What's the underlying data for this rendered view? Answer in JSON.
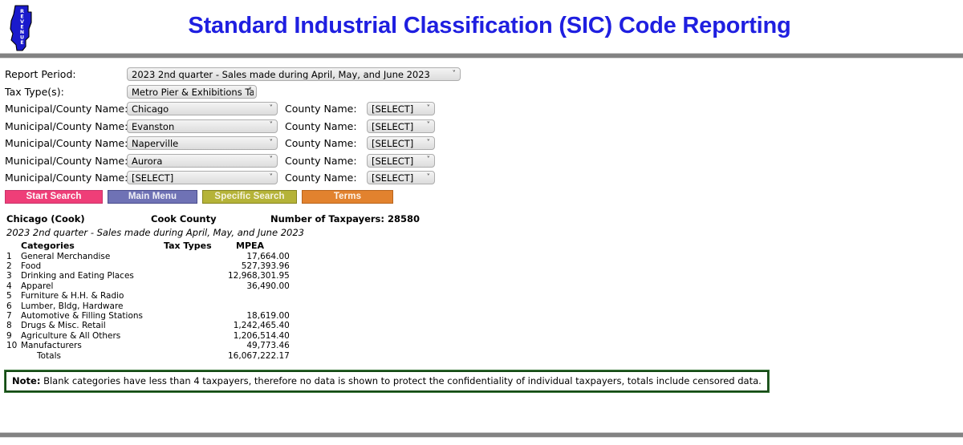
{
  "header": {
    "title": "Standard Industrial Classification (SIC) Code Reporting",
    "logo_text": "REVENUE",
    "title_color": "#1f1fe0"
  },
  "form": {
    "report_period_label": "Report Period:",
    "report_period_value": "2023 2nd quarter - Sales made during April, May, and June 2023",
    "tax_type_label": "Tax Type(s):",
    "tax_type_value": "Metro Pier & Exhibitions Tax",
    "municipal_label": "Municipal/County Name:",
    "county_label": "County Name:",
    "select_placeholder": "[SELECT]",
    "rows": [
      {
        "municipal": "Chicago",
        "county": "[SELECT]"
      },
      {
        "municipal": "Evanston",
        "county": "[SELECT]"
      },
      {
        "municipal": "Naperville",
        "county": "[SELECT]"
      },
      {
        "municipal": "Aurora",
        "county": "[SELECT]"
      },
      {
        "municipal": "[SELECT]",
        "county": "[SELECT]"
      }
    ]
  },
  "buttons": [
    {
      "label": "Start Search",
      "color": "#ef3e78"
    },
    {
      "label": "Main Menu",
      "color": "#6f72b5"
    },
    {
      "label": "Specific Search",
      "color": "#b5b338"
    },
    {
      "label": "Terms",
      "color": "#e2822e"
    }
  ],
  "results": {
    "location": "Chicago (Cook)",
    "county": "Cook County",
    "taxpayers": "Number of Taxpayers: 28580",
    "period": "2023 2nd quarter - Sales made during April, May, and June 2023",
    "columns": [
      "Categories",
      "Tax Types",
      "MPEA"
    ],
    "rows": [
      {
        "num": "1",
        "category": "General Merchandise",
        "tax_types": "",
        "mpea": "17,664.00"
      },
      {
        "num": "2",
        "category": "Food",
        "tax_types": "",
        "mpea": "527,393.96"
      },
      {
        "num": "3",
        "category": "Drinking and Eating Places",
        "tax_types": "",
        "mpea": "12,968,301.95"
      },
      {
        "num": "4",
        "category": "Apparel",
        "tax_types": "",
        "mpea": "36,490.00"
      },
      {
        "num": "5",
        "category": "Furniture & H.H. & Radio",
        "tax_types": "",
        "mpea": ""
      },
      {
        "num": "6",
        "category": "Lumber, Bldg, Hardware",
        "tax_types": "",
        "mpea": ""
      },
      {
        "num": "7",
        "category": "Automotive & Filling Stations",
        "tax_types": "",
        "mpea": "18,619.00"
      },
      {
        "num": "8",
        "category": "Drugs & Misc. Retail",
        "tax_types": "",
        "mpea": "1,242,465.40"
      },
      {
        "num": "9",
        "category": "Agriculture & All Others",
        "tax_types": "",
        "mpea": "1,206,514.40"
      },
      {
        "num": "10",
        "category": "Manufacturers",
        "tax_types": "",
        "mpea": "49,773.46"
      }
    ],
    "totals_label": "Totals",
    "totals_mpea": "16,067,222.17"
  },
  "note": {
    "prefix": "Note:",
    "text": " Blank categories have less than 4 taxpayers, therefore no data is shown to protect the confidentiality of individual taxpayers, totals include censored data.",
    "border_color": "#154a15"
  }
}
